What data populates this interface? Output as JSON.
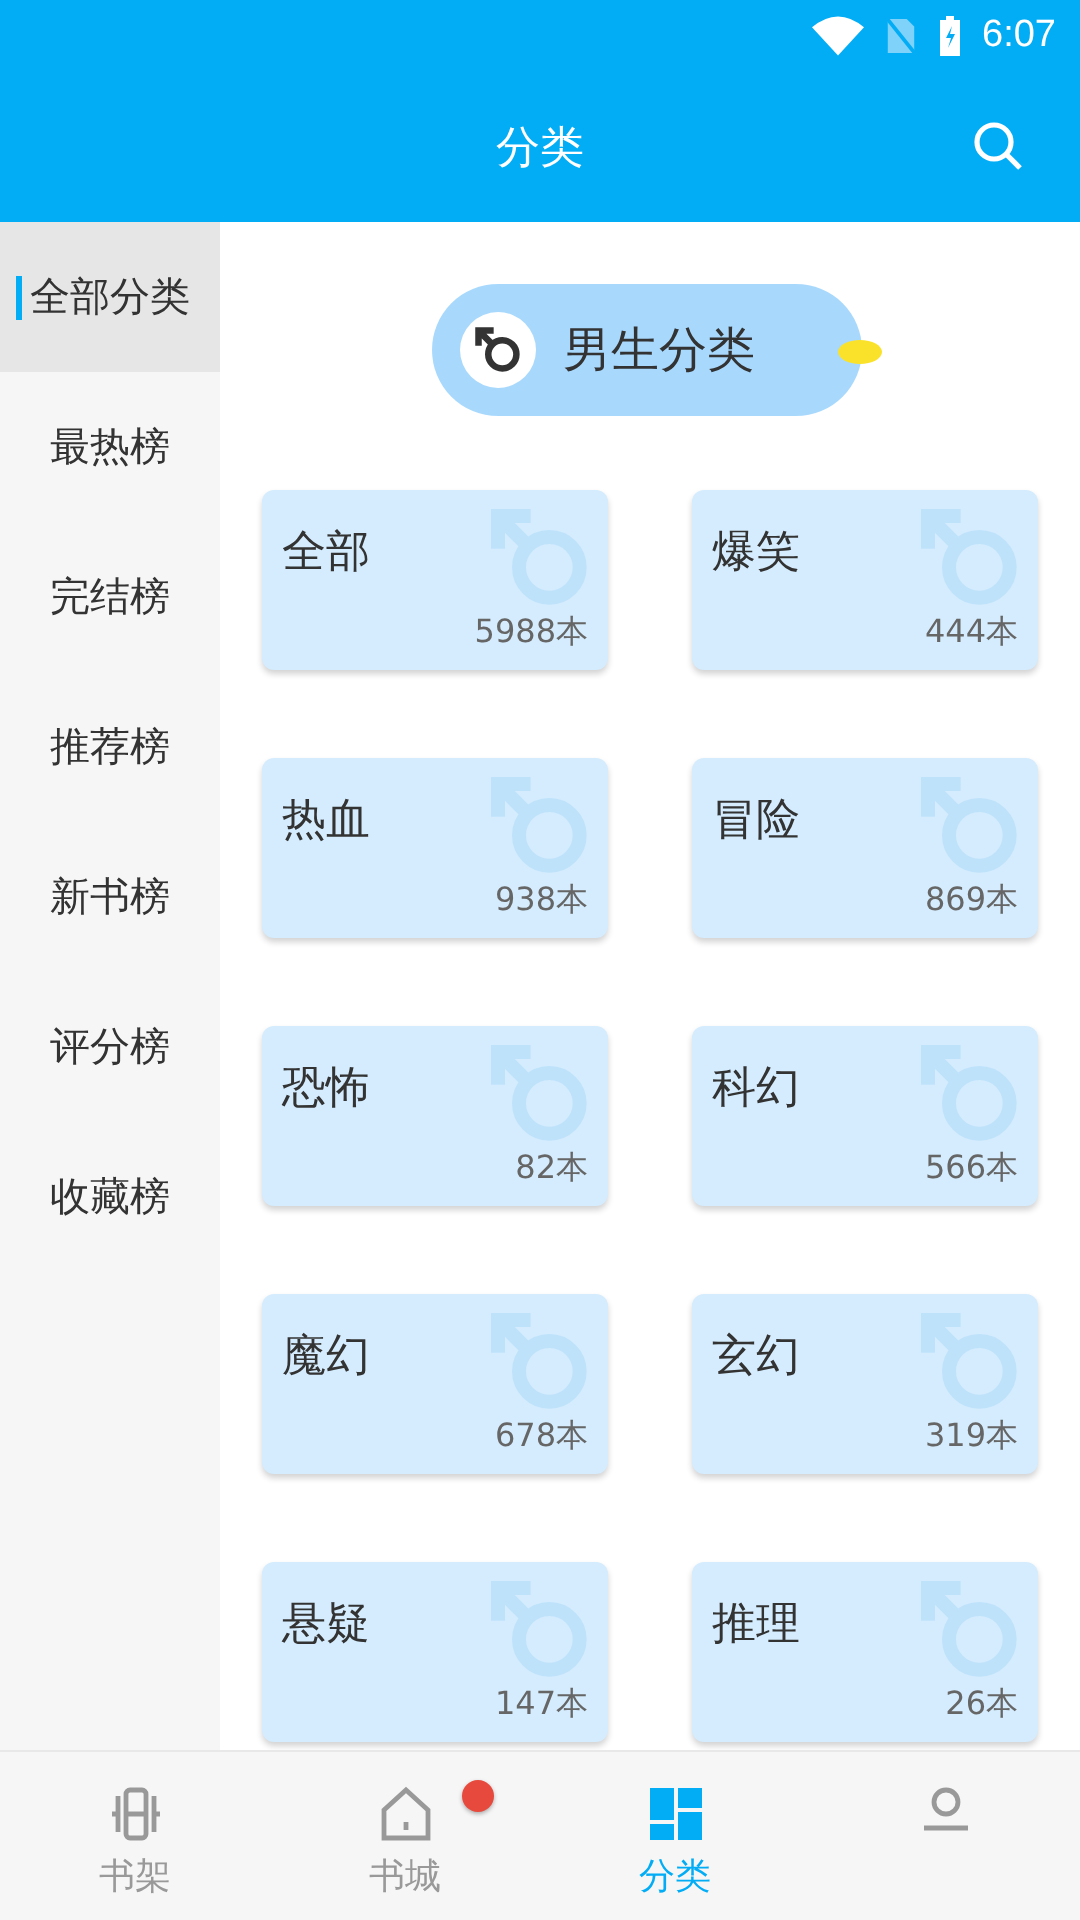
{
  "status_bar": {
    "time": "6:07"
  },
  "app_bar": {
    "title": "分类"
  },
  "sidebar": {
    "items": [
      {
        "label": "全部分类",
        "selected": true
      },
      {
        "label": "最热榜",
        "selected": false
      },
      {
        "label": "完结榜",
        "selected": false
      },
      {
        "label": "推荐榜",
        "selected": false
      },
      {
        "label": "新书榜",
        "selected": false
      },
      {
        "label": "评分榜",
        "selected": false
      },
      {
        "label": "收藏榜",
        "selected": false
      }
    ]
  },
  "section": {
    "title": "男生分类"
  },
  "categories": [
    {
      "name": "全部",
      "count": "5988本"
    },
    {
      "name": "爆笑",
      "count": "444本"
    },
    {
      "name": "热血",
      "count": "938本"
    },
    {
      "name": "冒险",
      "count": "869本"
    },
    {
      "name": "恐怖",
      "count": "82本"
    },
    {
      "name": "科幻",
      "count": "566本"
    },
    {
      "name": "魔幻",
      "count": "678本"
    },
    {
      "name": "玄幻",
      "count": "319本"
    },
    {
      "name": "悬疑",
      "count": "147本"
    },
    {
      "name": "推理",
      "count": "26本"
    }
  ],
  "bottom_nav": [
    {
      "kind": "shelf",
      "label": "书架",
      "selected": false,
      "badge": false
    },
    {
      "kind": "home",
      "label": "书城",
      "selected": false,
      "badge": true
    },
    {
      "kind": "grid",
      "label": "分类",
      "selected": true,
      "badge": false
    },
    {
      "kind": "person",
      "selected": false,
      "badge": false
    }
  ]
}
